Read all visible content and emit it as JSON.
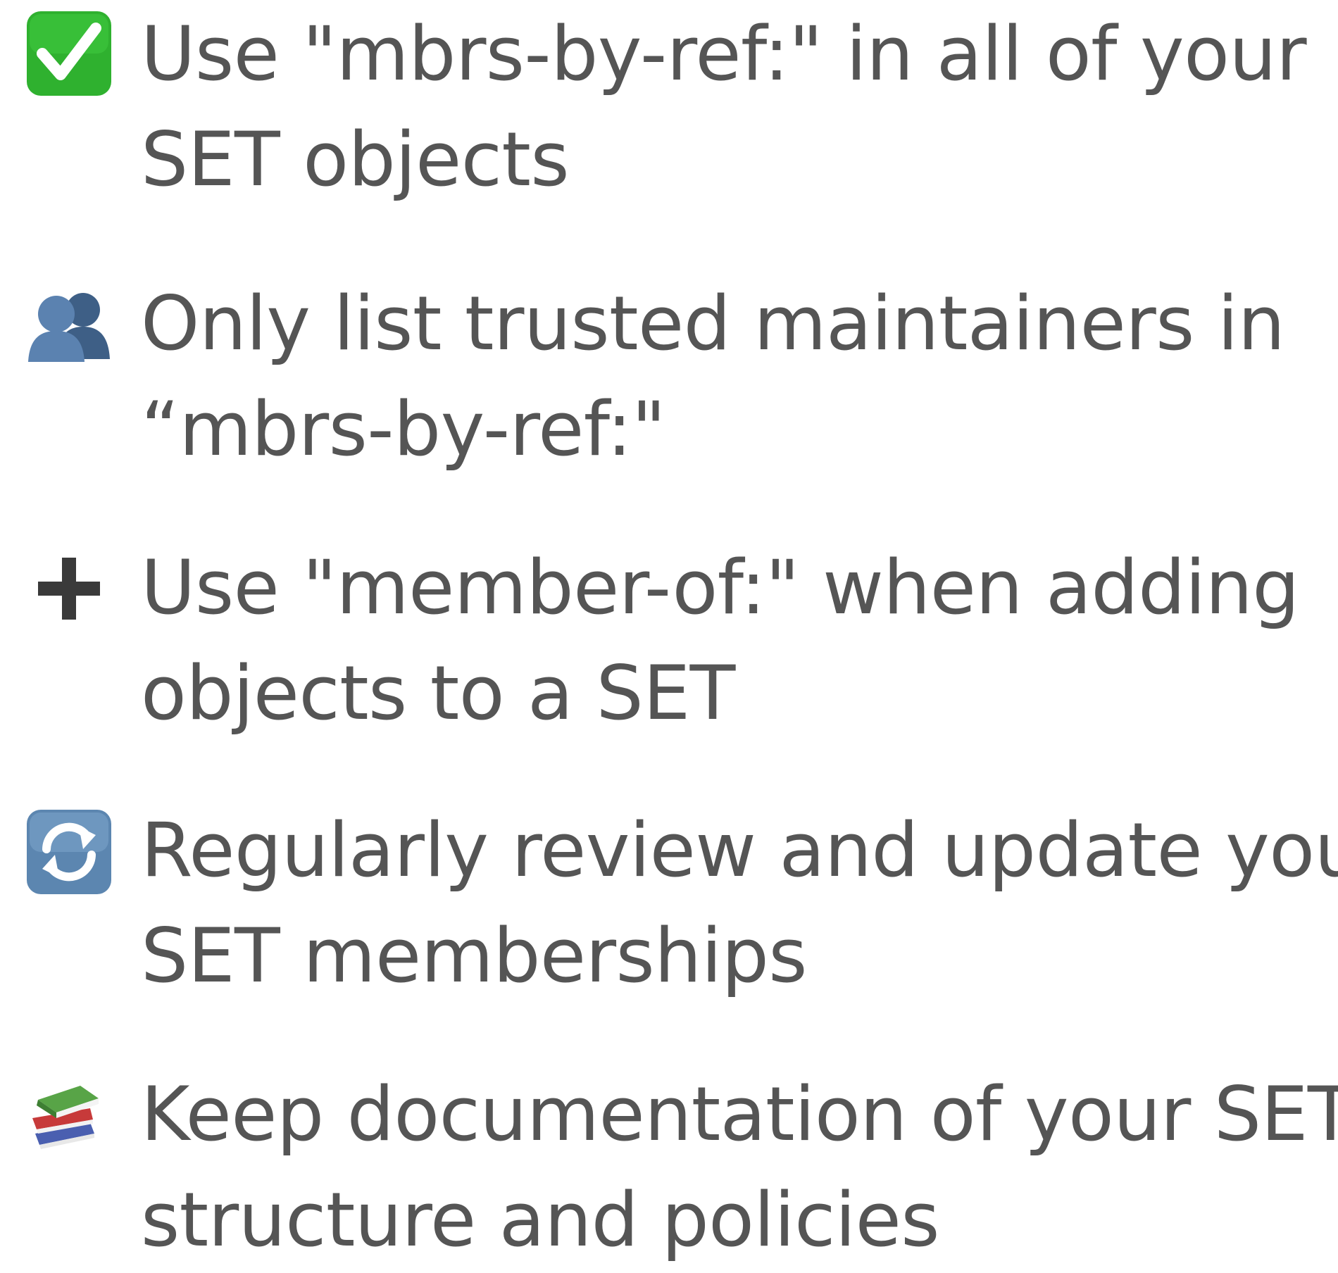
{
  "items": [
    {
      "icon": "check-mark-button-icon",
      "lines": [
        "Use \"mbrs-by-ref:\" in all of your",
        "SET objects"
      ]
    },
    {
      "icon": "busts-in-silhouette-icon",
      "lines": [
        "Only list trusted maintainers in",
        "“mbrs-by-ref:\""
      ]
    },
    {
      "icon": "heavy-plus-icon",
      "lines": [
        "Use \"member-of:\" when adding",
        "objects to a SET"
      ]
    },
    {
      "icon": "arrows-refresh-icon",
      "lines": [
        "Regularly review and update your",
        "SET memberships"
      ]
    },
    {
      "icon": "books-icon",
      "lines": [
        "Keep documentation of your SET",
        "structure and policies"
      ]
    }
  ],
  "colors": {
    "text": "#555555",
    "check_green": "#2FB12F",
    "silhouette_blue": "#4A6E9A",
    "plus_dark": "#3A3A3A",
    "refresh_blue": "#5C86B0"
  }
}
